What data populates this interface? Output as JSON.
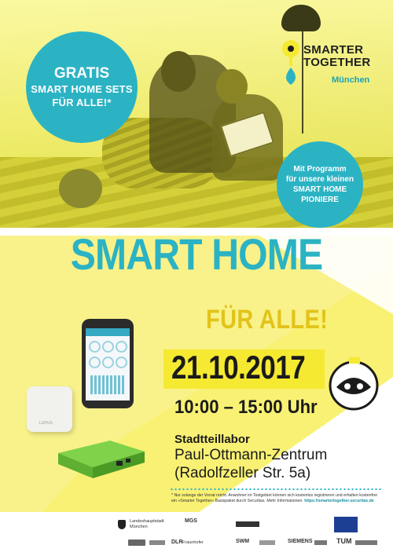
{
  "badge_gratis": {
    "line1": "GRATIS",
    "line2": "SMART HOME SETS",
    "line3": "FÜR ALLE!*"
  },
  "badge_pioniere": {
    "lines": [
      "Mit Programm",
      "für unsere kleinen",
      "SMART HOME",
      "PIONIERE"
    ]
  },
  "brand": {
    "line1": "SMARTER",
    "line2": "TOGETHER",
    "city": "München"
  },
  "headline": "SMART HOME",
  "subline": "FÜR ALLE!",
  "date": "21.10.2017",
  "time": "10:00 – 15:00 Uhr",
  "address": {
    "label": "Stadtteillabor",
    "line1": "Paul-Ottmann-Zentrum",
    "line2": "(Radolfzeller Str. 5a)"
  },
  "footnote": {
    "text": "* Nur solange der Vorrat reicht. Anwohner im Testgebiet können sich kostenlos registrieren und erhalten kostenfrei ein »Smarter Together« Basispaket durch Securitas.",
    "more_label": "Mehr Informationen:",
    "link": "https://smartertogether.securitas.de"
  },
  "logos": {
    "city_line1": "Landeshauptstadt",
    "city_line2": "München",
    "mgs": "MGS",
    "swm": "SWM",
    "siemens": "SIEMENS",
    "tum": "TUM",
    "fraunhofer": "Fraunhofer",
    "dlr": "DLR"
  },
  "device_labels": {
    "sensor": "LUPUS"
  },
  "colors": {
    "teal": "#2bb3c4",
    "yellow": "#f5e932",
    "gold": "#e2c31a",
    "dark": "#1b1b1b"
  }
}
